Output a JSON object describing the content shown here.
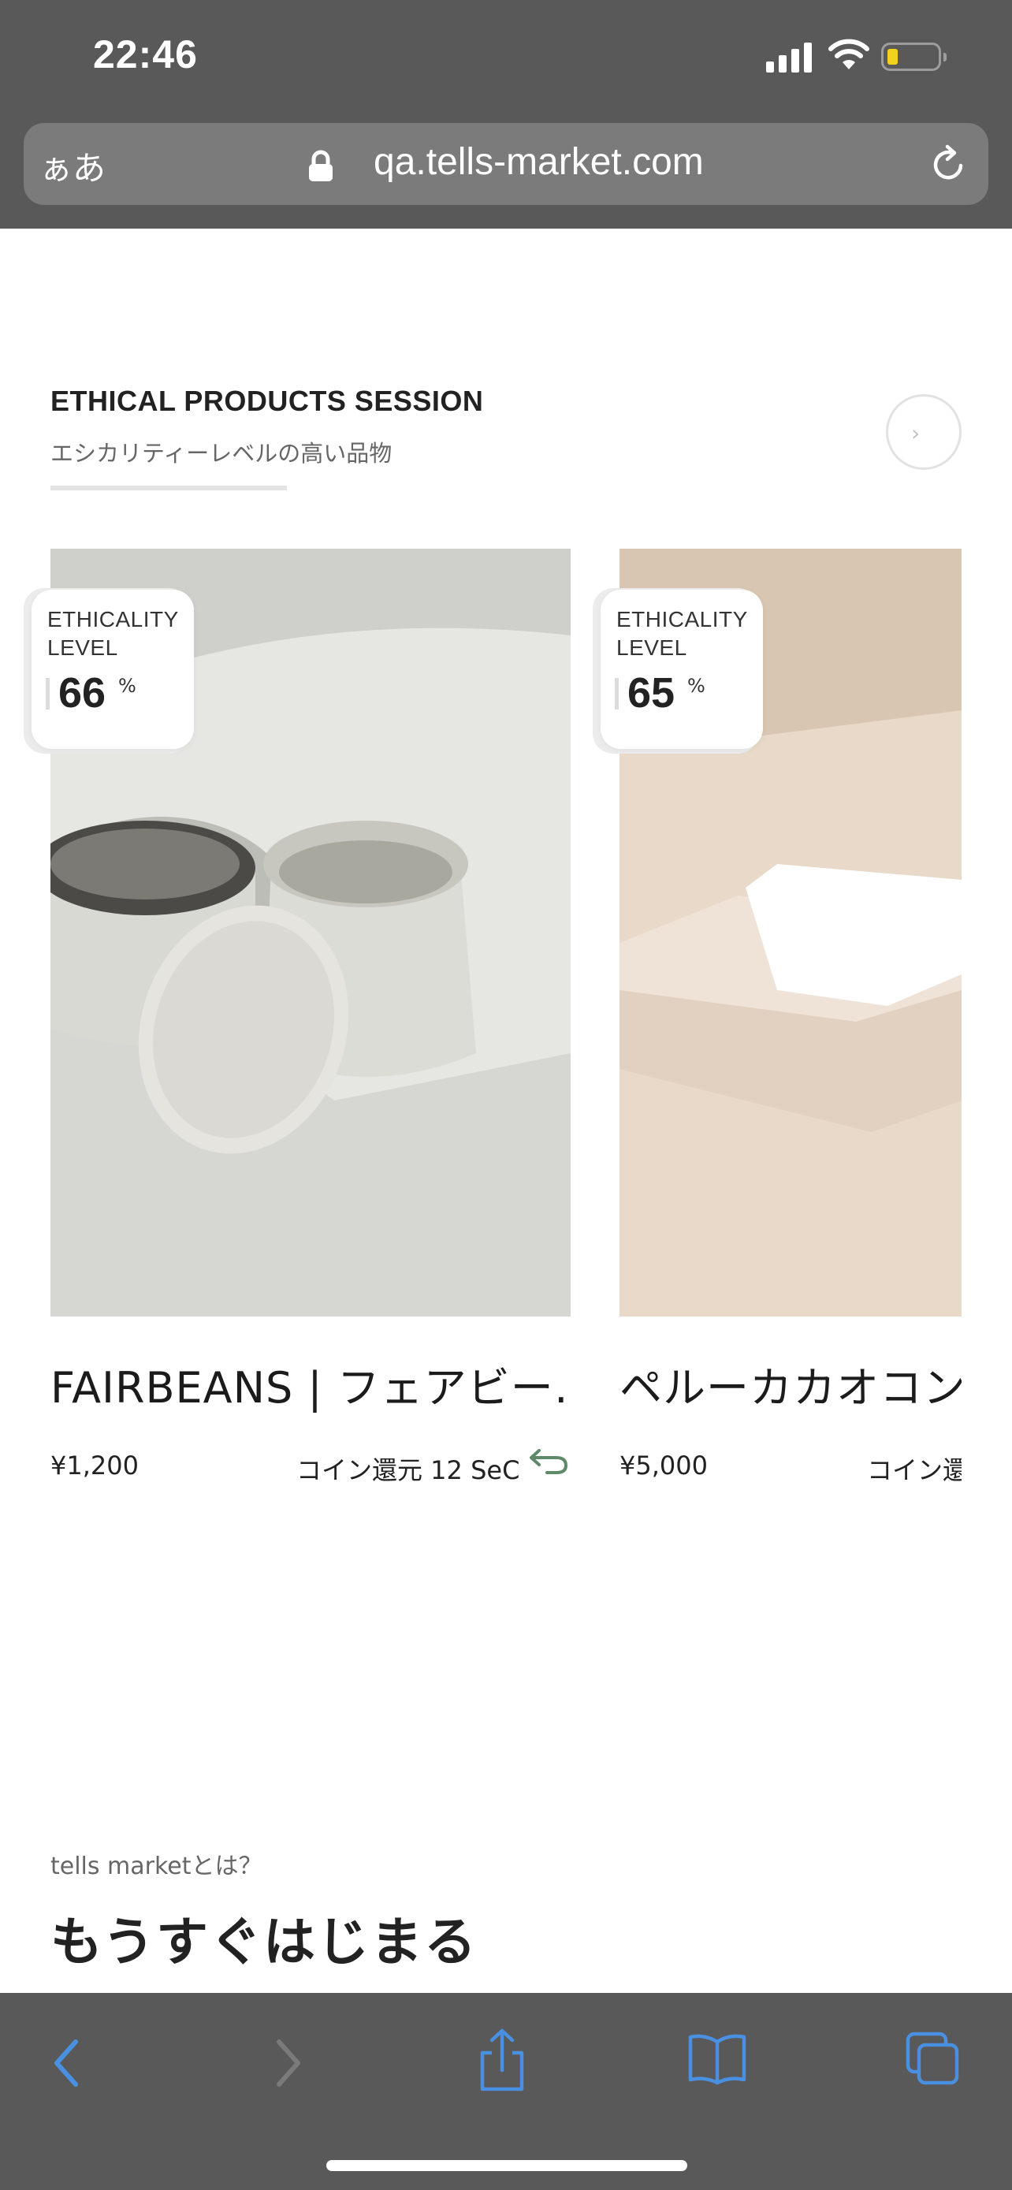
{
  "status_bar": {
    "time": "22:46"
  },
  "browser": {
    "text_size_label": "ぁあ",
    "url": "qa.tells-market.com"
  },
  "section": {
    "title": "ETHICAL PRODUCTS SESSION",
    "subtitle": "エシカリティーレベルの高い品物"
  },
  "products": [
    {
      "badge_label_line1": "ETHICALITY",
      "badge_label_line2": "LEVEL",
      "level": "66",
      "unit": "%",
      "name": "FAIRBEANS | フェアビー…",
      "price": "¥1,200",
      "coin": "コイン還元 12 SeC"
    },
    {
      "badge_label_line1": "ETHICALITY",
      "badge_label_line2": "LEVEL",
      "level": "65",
      "unit": "%",
      "name": "ペルーカカオコン",
      "price": "¥5,000",
      "coin": "コイン還"
    }
  ],
  "about": {
    "label": "tells marketとは？",
    "heading": "もうすぐはじまる"
  },
  "icons": {
    "nav_back": "chevron-left-icon",
    "nav_forward": "chevron-right-icon",
    "share": "share-icon",
    "bookmarks": "book-icon",
    "tabs": "tabs-icon"
  },
  "colors": {
    "chrome": "#595959",
    "ios_blue": "#4a90e2",
    "coin_accent": "#5e8a6a"
  }
}
